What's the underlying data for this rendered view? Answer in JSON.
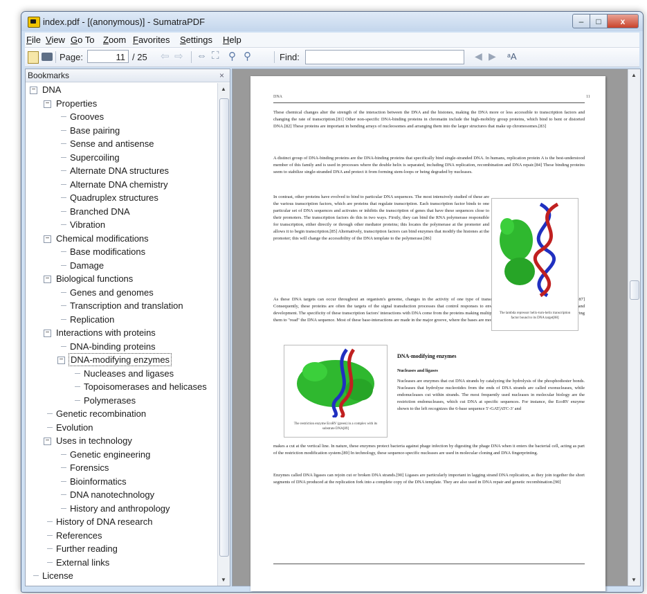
{
  "window": {
    "title": "index.pdf - [(anonymous)] - SumatraPDF",
    "minimize": "–",
    "maximize": "□",
    "close": "x"
  },
  "menu": [
    "File",
    "View",
    "Go To",
    "Zoom",
    "Favorites",
    "Settings",
    "Help"
  ],
  "toolbar": {
    "page_label": "Page:",
    "page_value": "11",
    "page_total": "/ 25",
    "find_label": "Find:",
    "find_value": "",
    "match_case": "ᵃA"
  },
  "sidebar": {
    "title": "Bookmarks",
    "close": "×",
    "items": [
      {
        "label": "DNA",
        "level": 0,
        "toggle": "−"
      },
      {
        "label": "Properties",
        "level": 1,
        "toggle": "−"
      },
      {
        "label": "Grooves",
        "level": 2
      },
      {
        "label": "Base pairing",
        "level": 2
      },
      {
        "label": "Sense and antisense",
        "level": 2
      },
      {
        "label": "Supercoiling",
        "level": 2
      },
      {
        "label": "Alternate DNA structures",
        "level": 2
      },
      {
        "label": "Alternate DNA chemistry",
        "level": 2
      },
      {
        "label": "Quadruplex structures",
        "level": 2
      },
      {
        "label": "Branched DNA",
        "level": 2
      },
      {
        "label": "Vibration",
        "level": 2
      },
      {
        "label": "Chemical modifications",
        "level": 1,
        "toggle": "−"
      },
      {
        "label": "Base modifications",
        "level": 2
      },
      {
        "label": "Damage",
        "level": 2
      },
      {
        "label": "Biological functions",
        "level": 1,
        "toggle": "−"
      },
      {
        "label": "Genes and genomes",
        "level": 2
      },
      {
        "label": "Transcription and translation",
        "level": 2
      },
      {
        "label": "Replication",
        "level": 2
      },
      {
        "label": "Interactions with proteins",
        "level": 1,
        "toggle": "−"
      },
      {
        "label": "DNA-binding proteins",
        "level": 2
      },
      {
        "label": "DNA-modifying enzymes",
        "level": 2,
        "toggle": "−",
        "selected": true
      },
      {
        "label": "Nucleases and ligases",
        "level": 3
      },
      {
        "label": "Topoisomerases and helicases",
        "level": 3
      },
      {
        "label": "Polymerases",
        "level": 3
      },
      {
        "label": "Genetic recombination",
        "level": 1
      },
      {
        "label": "Evolution",
        "level": 1
      },
      {
        "label": "Uses in technology",
        "level": 1,
        "toggle": "−"
      },
      {
        "label": "Genetic engineering",
        "level": 2
      },
      {
        "label": "Forensics",
        "level": 2
      },
      {
        "label": "Bioinformatics",
        "level": 2
      },
      {
        "label": "DNA nanotechnology",
        "level": 2
      },
      {
        "label": "History and anthropology",
        "level": 2
      },
      {
        "label": "History of DNA research",
        "level": 1
      },
      {
        "label": "References",
        "level": 1
      },
      {
        "label": "Further reading",
        "level": 1
      },
      {
        "label": "External links",
        "level": 1
      },
      {
        "label": "License",
        "level": 0
      }
    ]
  },
  "document": {
    "running_head": "DNA",
    "page_number": "11",
    "para1": "These chemical changes alter the strength of the interaction between the DNA and the histones, making the DNA more or less accessible to transcription factors and changing the rate of transcription.[81] Other non-specific DNA-binding proteins in chromatin include the high-mobility group proteins, which bind to bent or distorted DNA.[82] These proteins are important in bending arrays of nucleosomes and arranging them into the larger structures that make up chromosomes.[83]",
    "para2": "A distinct group of DNA-binding proteins are the DNA-binding proteins that specifically bind single-stranded DNA. In humans, replication protein A is the best-understood member of this family and is used in processes where the double helix is separated, including DNA replication, recombination and DNA repair.[84] These binding proteins seem to stabilize single-stranded DNA and protect it from forming stem-loops or being degraded by nucleases.",
    "para3": "In contrast, other proteins have evolved to bind to particular DNA sequences. The most intensively studied of these are the various transcription factors, which are proteins that regulate transcription. Each transcription factor binds to one particular set of DNA sequences and activates or inhibits the transcription of genes that have these sequences close to their promoters. The transcription factors do this in two ways. Firstly, they can bind the RNA polymerase responsible for transcription, either directly or through other mediator proteins; this locates the polymerase at the promoter and allows it to begin transcription.[85] Alternatively, transcription factors can bind enzymes that modify the histones at the promoter; this will change the accessibility of the DNA template to the polymerase.[86]",
    "para4": "As these DNA targets can occur throughout an organism's genome, changes in the activity of one type of transcription factor can affect thousands of genes.[87] Consequently, these proteins are often the targets of the signal transduction processes that control responses to environmental changes or cellular differentiation and development. The specificity of these transcription factors' interactions with DNA come from the proteins making multiple contacts to the edges of the DNA bases, allowing them to \"read\" the DNA sequence. Most of these base-interactions are made in the major groove, where the bases are most accessible.[13]",
    "fig1_caption": "The lambda repressor helix-turn-helix transcription factor bound to its DNA target[88]",
    "section_title": "DNA-modifying enzymes",
    "subsection_title": "Nucleases and ligases",
    "para5": "Nucleases are enzymes that cut DNA strands by catalyzing the hydrolysis of the phosphodiester bonds. Nucleases that hydrolyse nucleotides from the ends of DNA strands are called exonucleases, while endonucleases cut within strands. The most frequently used nucleases in molecular biology are the restriction endonucleases, which cut DNA at specific sequences. For instance, the EcoRV enzyme shown to the left recognizes the 6-base sequence 5′-GAT|ATC-3′ and",
    "para6": "makes a cut at the vertical line. In nature, these enzymes protect bacteria against phage infection by digesting the phage DNA when it enters the bacterial cell, acting as part of the restriction modification system.[89] In technology, these sequence-specific nucleases are used in molecular cloning and DNA fingerprinting.",
    "para7": "Enzymes called DNA ligases can rejoin cut or broken DNA strands.[90] Ligases are particularly important in lagging strand DNA replication, as they join together the short segments of DNA produced at the replication fork into a complete copy of the DNA template. They are also used in DNA repair and genetic recombination.[90]",
    "fig2_caption": "The restriction enzyme EcoRV (green) in a complex with its substrate DNA[89]"
  }
}
